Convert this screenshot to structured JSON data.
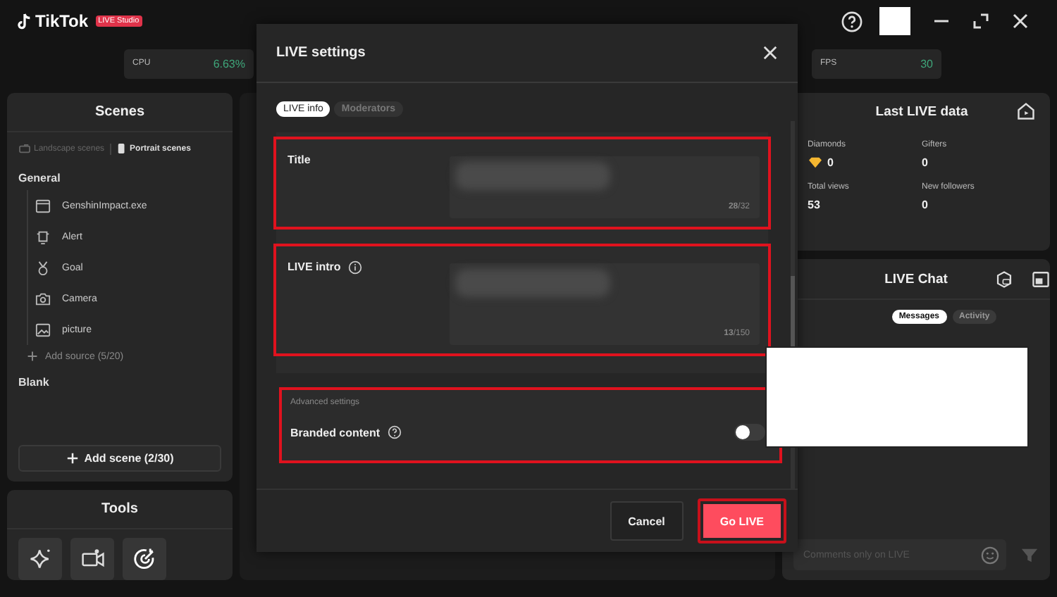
{
  "app": {
    "logo": "TikTok",
    "badge": "LIVE Studio"
  },
  "stats": [
    {
      "label": "CPU",
      "value": "6.63%"
    },
    {
      "label": "FPS",
      "value": "30"
    }
  ],
  "scenes": {
    "title": "Scenes",
    "modes": [
      {
        "label": "Landscape scenes",
        "selected": false
      },
      {
        "label": "Portrait scenes",
        "selected": true
      }
    ],
    "groups": [
      {
        "name": "General",
        "sources": [
          {
            "kind": "window",
            "label": "GenshinImpact.exe"
          },
          {
            "kind": "alert",
            "label": "Alert"
          },
          {
            "kind": "goal",
            "label": "Goal"
          },
          {
            "kind": "camera",
            "label": "Camera"
          },
          {
            "kind": "picture",
            "label": "picture"
          }
        ],
        "add_source": "Add source (5/20)"
      },
      {
        "name": "Blank"
      }
    ],
    "add_scene": "Add scene (2/30)"
  },
  "tools": {
    "title": "Tools",
    "items": [
      {
        "kind": "effects"
      },
      {
        "kind": "camera"
      },
      {
        "kind": "target"
      }
    ]
  },
  "last_live": {
    "title": "Last LIVE data",
    "metrics": [
      {
        "label": "Diamonds",
        "value": "0",
        "kind": "diamonds"
      },
      {
        "label": "Gifters",
        "value": "0",
        "kind": "plain"
      },
      {
        "label": "Total views",
        "value": "53",
        "kind": "plain"
      },
      {
        "label": "New followers",
        "value": "0",
        "kind": "plain"
      }
    ]
  },
  "chat": {
    "title": "LIVE Chat",
    "tabs": [
      {
        "label": "Messages",
        "selected": true
      },
      {
        "label": "Activity",
        "selected": false
      }
    ],
    "input": {
      "placeholder": "Comments only on LIVE"
    }
  },
  "modal": {
    "title": "LIVE settings",
    "tabs": [
      {
        "label": "LIVE info",
        "selected": true
      },
      {
        "label": "Moderators",
        "selected": false
      }
    ],
    "fields": [
      {
        "label": "Title",
        "info": false,
        "counter": "**28**/32",
        "highlighted": true
      },
      {
        "label": "LIVE intro",
        "info": true,
        "counter": "**13**/150",
        "highlighted": true
      }
    ],
    "advanced": {
      "heading": "Advanced settings",
      "label": "Branded content",
      "on": false,
      "highlighted": true
    },
    "buttons": [
      {
        "kind": "cancel",
        "label": "Cancel",
        "highlighted": false
      },
      {
        "kind": "primary",
        "label": "Go LIVE",
        "highlighted": true
      }
    ]
  }
}
